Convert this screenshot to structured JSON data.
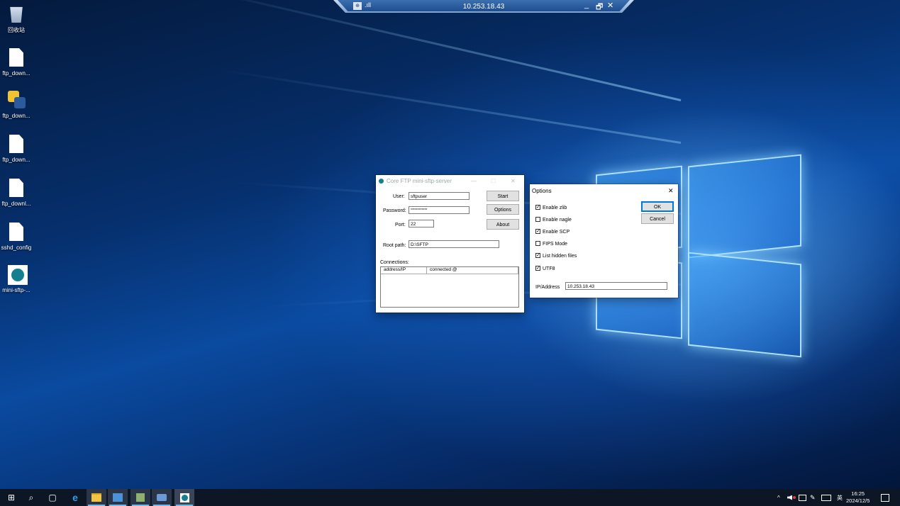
{
  "remote_bar": {
    "pin_icon": "pin-icon",
    "signal_icon": "signal-icon",
    "signal_glyph": ".ıll",
    "title": "10.253.18.43",
    "minimize_glyph": "_",
    "restore_glyph": "🗗",
    "close_glyph": "✕"
  },
  "desktop_icons": [
    {
      "label": "回收站",
      "icon": "recycle-bin-icon"
    },
    {
      "label": "ftp_down...",
      "icon": "document-icon"
    },
    {
      "label": "ftp_down...",
      "icon": "python-file-icon"
    },
    {
      "label": "ftp_down...",
      "icon": "document-icon"
    },
    {
      "label": "ftp_downl...",
      "icon": "document-icon"
    },
    {
      "label": "sshd_config",
      "icon": "document-icon"
    },
    {
      "label": "mini-sftp-...",
      "icon": "sftp-app-icon"
    }
  ],
  "main_window": {
    "title": "Core FTP mini-sftp-server",
    "minimize_glyph": "—",
    "maximize_glyph": "☐",
    "close_glyph": "✕",
    "user_label": "User:",
    "user_value": "sftpuser",
    "password_label": "Password:",
    "password_value": "************",
    "port_label": "Port:",
    "port_value": "22",
    "rootpath_label": "Root path:",
    "rootpath_value": "D:\\SFTP",
    "start_button": "Start",
    "options_button": "Options",
    "about_button": "About",
    "connections_label": "Connections:",
    "columns": [
      "address/IP",
      "connected @"
    ]
  },
  "options_dialog": {
    "title": "Options",
    "close_glyph": "✕",
    "checkboxes": [
      {
        "label": "Enable zlib",
        "checked": true
      },
      {
        "label": "Enable nagle",
        "checked": false
      },
      {
        "label": "Enable SCP",
        "checked": true
      },
      {
        "label": "FIPS Mode",
        "checked": false
      },
      {
        "label": "List hidden files",
        "checked": true
      },
      {
        "label": "UTF8",
        "checked": true
      }
    ],
    "check_glyph": "✓",
    "ok_button": "OK",
    "cancel_button": "Cancel",
    "ip_label": "IP/Address",
    "ip_value": "10.253.18.43"
  },
  "taskbar": {
    "start_glyph": "⊞",
    "search_glyph": "⌕",
    "taskview_glyph": "▢",
    "pinned": [
      "start-icon",
      "search-icon",
      "task-view-icon",
      "ie-icon",
      "file-explorer-icon",
      "server-manager-icon",
      "app-icon",
      "network-icon",
      "sftp-server-icon"
    ],
    "tray_chevron": "^",
    "ime": "英",
    "time": "16:25",
    "date": "2024/12/5"
  }
}
